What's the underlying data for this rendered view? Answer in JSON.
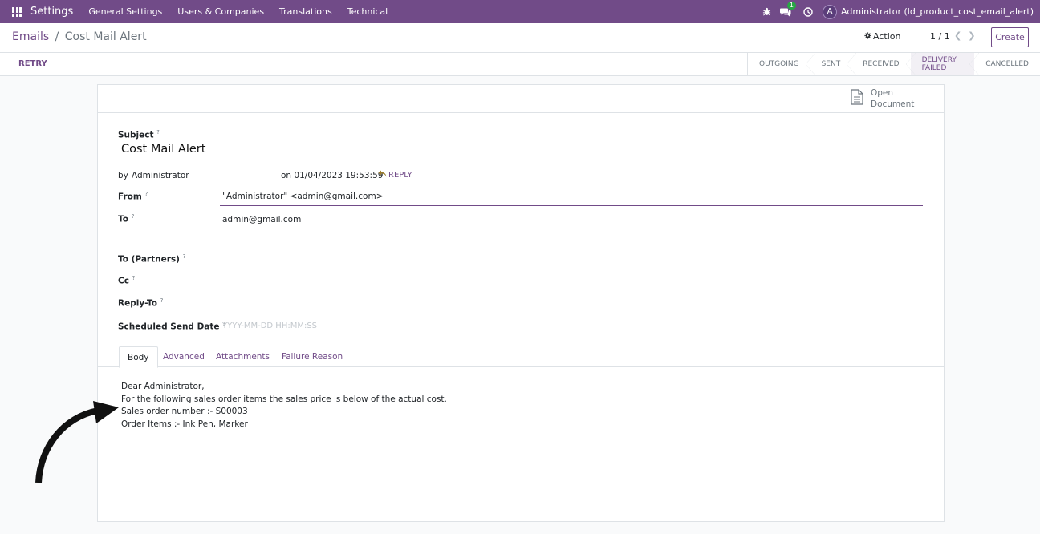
{
  "navbar": {
    "brand": "Settings",
    "menus": [
      "General Settings",
      "Users & Companies",
      "Translations",
      "Technical"
    ],
    "chat_badge": "1",
    "avatar_letter": "A",
    "user": "Administrator (ld_product_cost_email_alert)"
  },
  "control": {
    "breadcrumb_parent": "Emails",
    "breadcrumb_sep": "/",
    "breadcrumb_current": "Cost Mail Alert",
    "action_label": "Action",
    "pager": "1 / 1",
    "create_label": "Create"
  },
  "statusbar": {
    "retry_label": "RETRY",
    "stages": [
      "OUTGOING",
      "SENT",
      "RECEIVED",
      "DELIVERY FAILED",
      "CANCELLED"
    ],
    "active_stage": "DELIVERY FAILED"
  },
  "sheet": {
    "open_document": [
      "Open",
      "Document"
    ],
    "subject_label": "Subject",
    "subject": "Cost Mail Alert",
    "by_label": "by",
    "author": "Administrator",
    "date": "on 01/04/2023 19:53:59",
    "reply_label": "REPLY",
    "from_label": "From",
    "from_value": "\"Administrator\" <admin@gmail.com>",
    "to_label": "To",
    "to_value": "admin@gmail.com",
    "to_partners_label": "To (Partners)",
    "cc_label": "Cc",
    "reply_to_label": "Reply-To",
    "scheduled_label": "Scheduled Send Date",
    "scheduled_placeholder": "YYYY-MM-DD HH:MM:SS",
    "help_mark": "?"
  },
  "tabs": [
    "Body",
    "Advanced",
    "Attachments",
    "Failure Reason"
  ],
  "body_lines": [
    "Dear Administrator,",
    "For the following sales order items the sales price is below of the actual cost.",
    "Sales order number :- S00003",
    "Order Items :- Ink Pen, Marker"
  ],
  "colors": {
    "brand": "#714b88",
    "badge": "#28a745"
  }
}
